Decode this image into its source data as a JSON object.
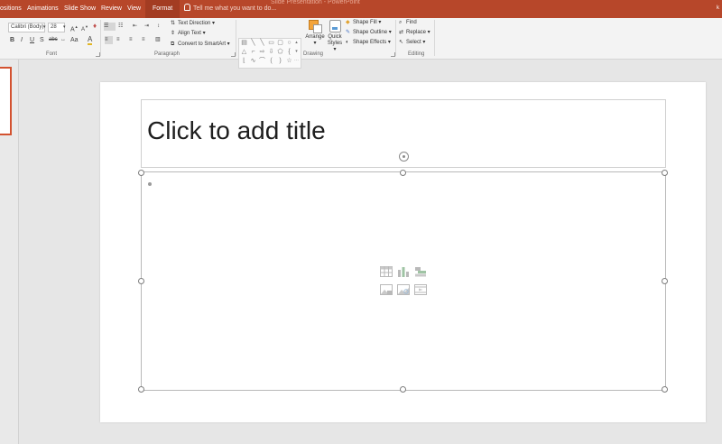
{
  "title_bar": {
    "tabs": [
      "ositions",
      "Animations",
      "Slide Show",
      "Review",
      "View",
      "Format"
    ],
    "active_tab": "Format",
    "tell_me": "Tell me what you want to do...",
    "document_title": "Slide Presentation - PowerPoint",
    "user_initial": "k",
    "accent_color": "#b7472a"
  },
  "ribbon": {
    "font": {
      "label": "Font",
      "font_name": "Calibri (Body)",
      "font_size": "28",
      "bold": "B",
      "italic": "I",
      "underline": "U",
      "strike": "S",
      "spacing": "abc",
      "case": "Aa",
      "font_color": "A"
    },
    "paragraph": {
      "label": "Paragraph",
      "text_direction": "Text Direction",
      "align_text": "Align Text",
      "convert_smartart": "Convert to SmartArt"
    },
    "drawing": {
      "label": "Drawing",
      "arrange": "Arrange",
      "quick_styles": "Quick Styles",
      "shape_fill": "Shape Fill",
      "shape_outline": "Shape Outline",
      "shape_effects": "Shape Effects"
    },
    "editing": {
      "label": "Editing",
      "find": "Find",
      "replace": "Replace",
      "select": "Select"
    }
  },
  "slide": {
    "title_placeholder": "Click to add title"
  },
  "icons": {
    "content_insert": [
      "table-icon",
      "chart-icon",
      "smartart-icon",
      "picture-icon",
      "online-picture-icon",
      "video-icon"
    ]
  }
}
